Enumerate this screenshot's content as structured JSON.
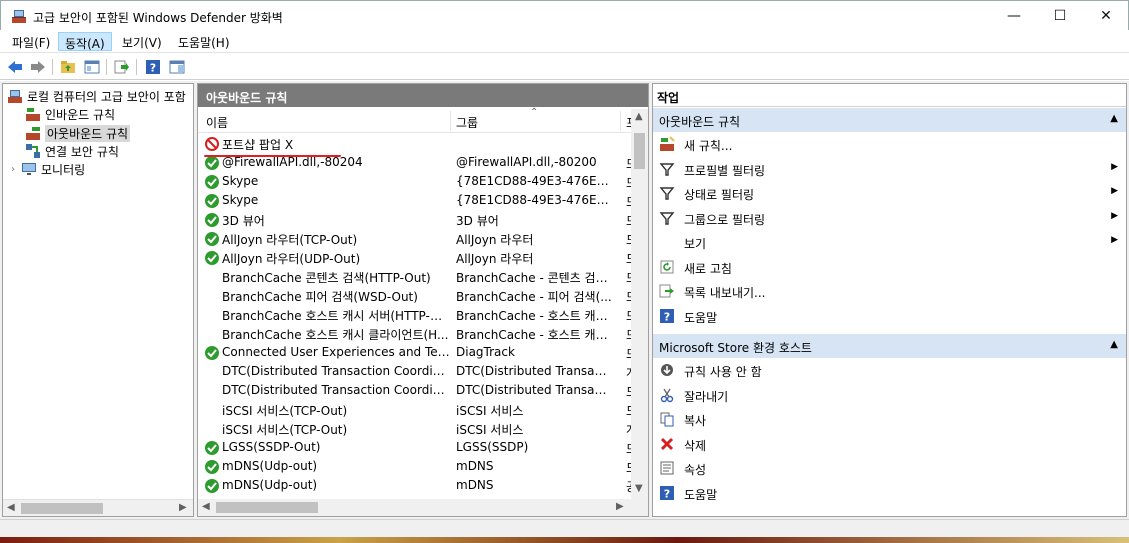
{
  "window": {
    "title": "고급 보안이 포함된 Windows Defender 방화벽",
    "icon": "firewall-icon",
    "minimize": "—",
    "maximize": "☐",
    "close": "✕"
  },
  "menu": [
    "파일(F)",
    "동작(A)",
    "보기(V)",
    "도움말(H)"
  ],
  "menu_active_index": 1,
  "tree": {
    "root": "로컬 컴퓨터의 고급 보안이 포함",
    "items": [
      "인바운드 규칙",
      "아웃바운드 규칙",
      "연결 보안 규칙",
      "모니터링"
    ],
    "selected_index": 1
  },
  "middle": {
    "header": "아웃바운드 규칙",
    "col_name": "이름",
    "col_group": "그룹",
    "col_profile": "프",
    "rows": [
      {
        "name": "포트샵 팝업 X",
        "group": "",
        "profile": "",
        "status": "blocked"
      },
      {
        "name": "@FirewallAPI.dll,-80204",
        "group": "@FirewallAPI.dll,-80200",
        "profile": "모",
        "status": "allowed"
      },
      {
        "name": "Skype",
        "group": "{78E1CD88-49E3-476E-B9...",
        "profile": "모",
        "status": "allowed"
      },
      {
        "name": "Skype",
        "group": "{78E1CD88-49E3-476E-B9...",
        "profile": "모",
        "status": "allowed"
      },
      {
        "name": "3D 뷰어",
        "group": "3D 뷰어",
        "profile": "모",
        "status": "allowed"
      },
      {
        "name": "AllJoyn 라우터(TCP-Out)",
        "group": "AllJoyn 라우터",
        "profile": "도",
        "status": "allowed"
      },
      {
        "name": "AllJoyn 라우터(UDP-Out)",
        "group": "AllJoyn 라우터",
        "profile": "도",
        "status": "allowed"
      },
      {
        "name": "BranchCache 콘텐츠 검색(HTTP-Out)",
        "group": "BranchCache - 콘텐츠 검색...",
        "profile": "모",
        "status": "none"
      },
      {
        "name": "BranchCache 피어 검색(WSD-Out)",
        "group": "BranchCache - 피어 검색(...",
        "profile": "모",
        "status": "none"
      },
      {
        "name": "BranchCache 호스트 캐시 서버(HTTP-O...",
        "group": "BranchCache - 호스트 캐시...",
        "profile": "모",
        "status": "none"
      },
      {
        "name": "BranchCache 호스트 캐시 클라이언트(H...",
        "group": "BranchCache - 호스트 캐시...",
        "profile": "모",
        "status": "none"
      },
      {
        "name": "Connected User Experiences and Teleme...",
        "group": "DiagTrack",
        "profile": "모",
        "status": "allowed"
      },
      {
        "name": "DTC(Distributed Transaction Coordinato...",
        "group": "DTC(Distributed Transactio...",
        "profile": "개",
        "status": "none"
      },
      {
        "name": "DTC(Distributed Transaction Coordinato...",
        "group": "DTC(Distributed Transactio...",
        "profile": "도",
        "status": "none"
      },
      {
        "name": "iSCSI 서비스(TCP-Out)",
        "group": "iSCSI 서비스",
        "profile": "도",
        "status": "none"
      },
      {
        "name": "iSCSI 서비스(TCP-Out)",
        "group": "iSCSI 서비스",
        "profile": "개",
        "status": "none"
      },
      {
        "name": "LGSS(SSDP-Out)",
        "group": "LGSS(SSDP)",
        "profile": "모",
        "status": "allowed"
      },
      {
        "name": "mDNS(Udp-out)",
        "group": "mDNS",
        "profile": "도",
        "status": "allowed"
      },
      {
        "name": "mDNS(Udp-out)",
        "group": "mDNS",
        "profile": "공",
        "status": "allowed"
      }
    ]
  },
  "right": {
    "header": "작업",
    "section1": {
      "title": "아웃바운드 규칙",
      "actions": [
        {
          "label": "새 규칙...",
          "icon": "new-rule-icon",
          "submenu": false
        },
        {
          "label": "프로필별 필터링",
          "icon": "filter-icon",
          "submenu": true
        },
        {
          "label": "상태로 필터링",
          "icon": "filter-icon",
          "submenu": true
        },
        {
          "label": "그룹으로 필터링",
          "icon": "filter-icon",
          "submenu": true
        },
        {
          "label": "보기",
          "icon": "",
          "submenu": true
        },
        {
          "label": "새로 고침",
          "icon": "refresh-icon",
          "submenu": false
        },
        {
          "label": "목록 내보내기...",
          "icon": "export-icon",
          "submenu": false
        },
        {
          "label": "도움말",
          "icon": "help-icon",
          "submenu": false
        }
      ]
    },
    "section2": {
      "title": "Microsoft Store 환경 호스트",
      "actions": [
        {
          "label": "규칙 사용 안 함",
          "icon": "disable-icon"
        },
        {
          "label": "잘라내기",
          "icon": "cut-icon"
        },
        {
          "label": "복사",
          "icon": "copy-icon"
        },
        {
          "label": "삭제",
          "icon": "delete-icon"
        },
        {
          "label": "속성",
          "icon": "properties-icon"
        },
        {
          "label": "도움말",
          "icon": "help-icon"
        }
      ]
    }
  },
  "colors": {
    "allowed": "#2e9b2e",
    "blocked": "#d42020",
    "section_bg": "#d6e4f3",
    "header_bg": "#7a7a7a"
  }
}
